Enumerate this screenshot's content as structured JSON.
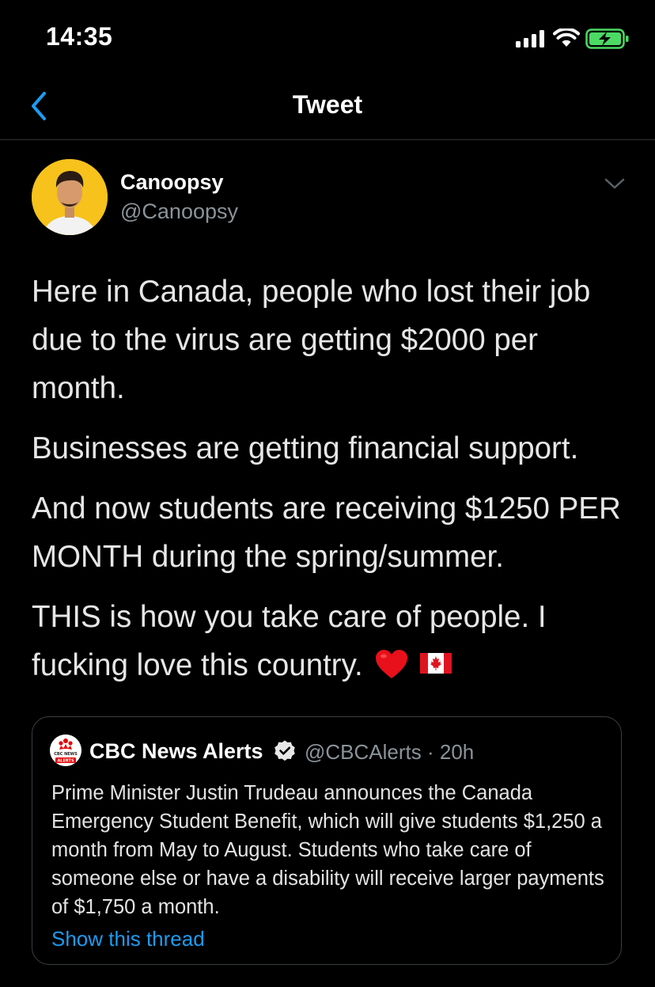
{
  "status_bar": {
    "time": "14:35"
  },
  "nav": {
    "title": "Tweet"
  },
  "author": {
    "name": "Canoopsy",
    "handle": "@Canoopsy",
    "avatar_color": "#f6c21b"
  },
  "tweet": {
    "paragraphs": [
      "Here in Canada, people who lost their job due to the virus are getting $2000 per month.",
      "Businesses are getting financial support.",
      "And now students are receiving $1250 PER MONTH during the spring/summer.",
      "THIS is how you take care of people. I fucking love this country."
    ],
    "emojis": [
      "red-heart",
      "canada-flag"
    ]
  },
  "quote": {
    "name": "CBC News Alerts",
    "handle_time": "@CBCAlerts · 20h",
    "avatar_text_top": "CBC NEWS",
    "avatar_text_bottom": "ALERTS",
    "text": "Prime Minister Justin Trudeau announces the Canada Emergency Student Benefit, which will give students $1,250 a month from May to August. Students who take care of someone else or have a disability will receive larger payments of $1,750 a month.",
    "link": "Show this thread"
  },
  "colors": {
    "background": "#000000",
    "accent": "#1d9bf0",
    "secondary_text": "#8b9399",
    "battery": "#4cd964"
  }
}
